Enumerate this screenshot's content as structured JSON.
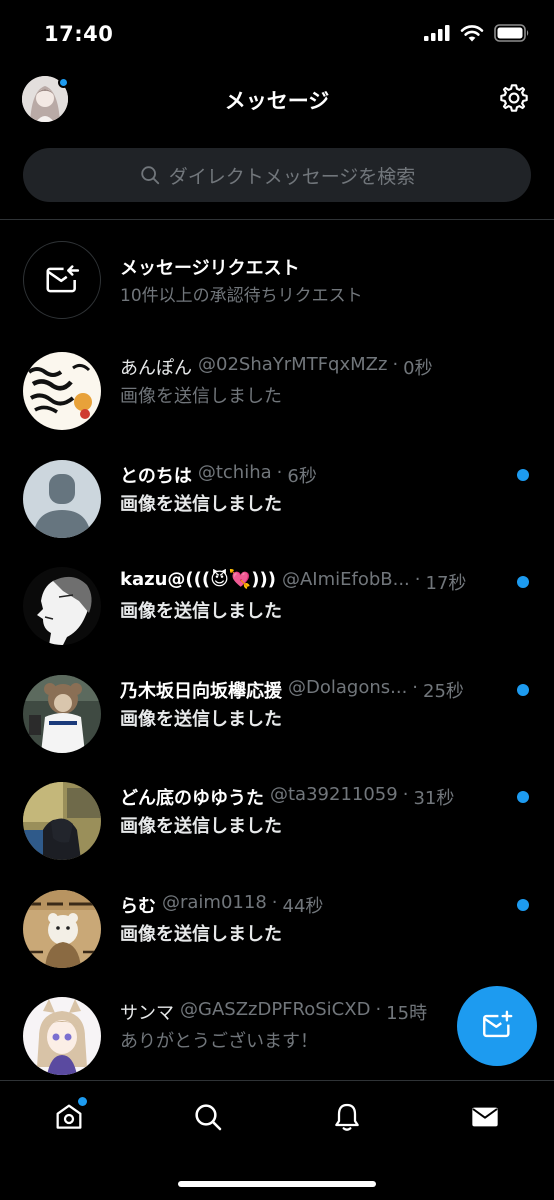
{
  "status_bar": {
    "time": "17:40"
  },
  "header": {
    "title": "メッセージ"
  },
  "search": {
    "placeholder": "ダイレクトメッセージを検索"
  },
  "request": {
    "title": "メッセージリクエスト",
    "subtitle": "10件以上の承認待ちリクエスト"
  },
  "messages": [
    {
      "name": "あんぽん",
      "handle": "@02ShaYrMTFqxMZz",
      "time": "0秒",
      "preview": "画像を送信しました",
      "unread": false
    },
    {
      "name": "とのちは",
      "handle": "@tchiha",
      "time": "6秒",
      "preview": "画像を送信しました",
      "unread": true
    },
    {
      "name": "kazu@(((😈💘)))",
      "handle": "@AImiEfobB...",
      "time": "17秒",
      "preview": "画像を送信しました",
      "unread": true
    },
    {
      "name": "乃木坂日向坂欅応援",
      "handle": "@Dolagons...",
      "time": "25秒",
      "preview": "画像を送信しました",
      "unread": true
    },
    {
      "name": "どん底のゆゆうた",
      "handle": "@ta39211059",
      "time": "31秒",
      "preview": "画像を送信しました",
      "unread": true
    },
    {
      "name": "らむ",
      "handle": "@raim0118",
      "time": "44秒",
      "preview": "画像を送信しました",
      "unread": true
    },
    {
      "name": "サンマ",
      "handle": "@GASZzDPFRoSiCXD",
      "time": "15時",
      "preview": "ありがとうございます！",
      "unread": false
    }
  ],
  "icons": {
    "settings": "gear-icon",
    "search": "search-icon",
    "request": "mail-request-icon",
    "compose": "compose-mail-icon",
    "nav": [
      "home-icon",
      "search-icon",
      "bell-icon",
      "mail-icon"
    ]
  },
  "colors": {
    "accent": "#1d9bf0",
    "background": "#000000",
    "secondary_text": "#71767b"
  }
}
